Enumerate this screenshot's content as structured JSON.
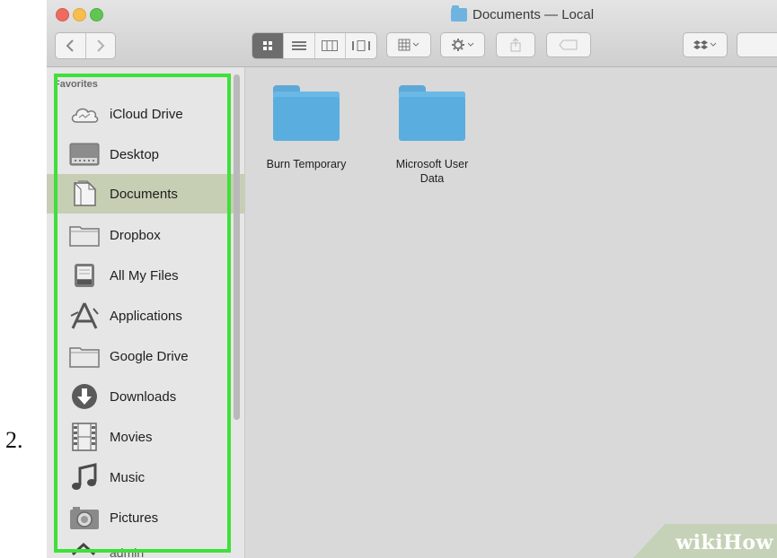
{
  "step_number": "2.",
  "window": {
    "title": "Documents — Local"
  },
  "toolbar": {
    "back_icon": "chevron-left-icon",
    "forward_icon": "chevron-right-icon",
    "views": [
      "icon-view",
      "list-view",
      "column-view",
      "cover-flow-view"
    ],
    "active_view": "icon-view",
    "arrange_icon": "grid-arrange-icon",
    "action_icon": "gear-icon",
    "share_icon": "share-icon",
    "tag_icon": "tag-icon",
    "dropbox_icon": "dropbox-icon"
  },
  "sidebar": {
    "section_label": "Favorites",
    "items": [
      {
        "label": "iCloud Drive",
        "icon": "cloud-icon"
      },
      {
        "label": "Desktop",
        "icon": "desktop-icon"
      },
      {
        "label": "Documents",
        "icon": "documents-icon",
        "selected": true
      },
      {
        "label": "Dropbox",
        "icon": "folder-icon"
      },
      {
        "label": "All My Files",
        "icon": "file-drawer-icon"
      },
      {
        "label": "Applications",
        "icon": "applications-icon"
      },
      {
        "label": "Google Drive",
        "icon": "folder-icon"
      },
      {
        "label": "Downloads",
        "icon": "download-icon"
      },
      {
        "label": "Movies",
        "icon": "film-icon"
      },
      {
        "label": "Music",
        "icon": "music-note-icon"
      },
      {
        "label": "Pictures",
        "icon": "camera-icon"
      },
      {
        "label": "admin",
        "icon": "home-icon"
      }
    ]
  },
  "files": [
    {
      "name": "Burn Temporary"
    },
    {
      "name": "Microsoft User Data"
    }
  ],
  "watermark": {
    "wiki": "wiki",
    "how": "How"
  },
  "colors": {
    "highlight": "#3fe03a",
    "folder": "#5aaedf",
    "selected_row": "#c6ceb4"
  }
}
